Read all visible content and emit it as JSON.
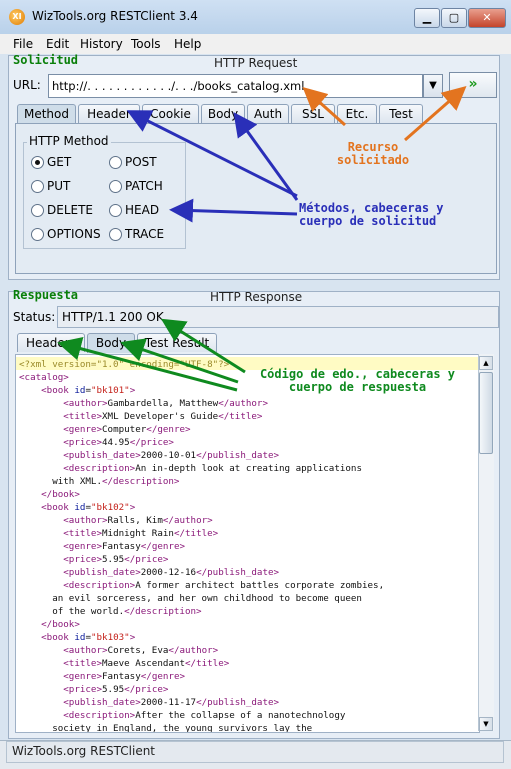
{
  "window": {
    "title": "WizTools.org RESTClient 3.4",
    "icon_text": "XI"
  },
  "window_controls": {
    "minimize": "▁",
    "maximize": "▢",
    "close": "✕"
  },
  "menu": [
    "File",
    "Edit",
    "History",
    "Tools",
    "Help"
  ],
  "request": {
    "section_label": "Solicitud",
    "title": "HTTP Request",
    "url_label": "URL:",
    "url_value": "http://. . . . . . . . . . . ./. . ./books_catalog.xml",
    "dropdown_icon": "▼",
    "go_button": "»",
    "tabs": [
      "Method",
      "Header",
      "Cookie",
      "Body",
      "Auth",
      "SSL",
      "Etc.",
      "Test"
    ],
    "selected_tab": "Method",
    "method_group_title": "HTTP Method",
    "methods": [
      "GET",
      "POST",
      "PUT",
      "PATCH",
      "DELETE",
      "HEAD",
      "OPTIONS",
      "TRACE"
    ],
    "selected_method": "GET"
  },
  "response": {
    "section_label": "Respuesta",
    "title": "HTTP Response",
    "status_label": "Status:",
    "status_value": "HTTP/1.1 200 OK",
    "tabs": [
      "Headers",
      "Body",
      "Test Result"
    ],
    "selected_tab": "Body",
    "body_lines": [
      "<?xml version=\"1.0\" encoding=\"UTF-8\"?>",
      "<catalog>",
      "    <book id=\"bk101\">",
      "        <author>Gambardella, Matthew</author>",
      "        <title>XML Developer's Guide</title>",
      "        <genre>Computer</genre>",
      "        <price>44.95</price>",
      "        <publish_date>2000-10-01</publish_date>",
      "        <description>An in-depth look at creating applications",
      "      with XML.</description>",
      "    </book>",
      "    <book id=\"bk102\">",
      "        <author>Ralls, Kim</author>",
      "        <title>Midnight Rain</title>",
      "        <genre>Fantasy</genre>",
      "        <price>5.95</price>",
      "        <publish_date>2000-12-16</publish_date>",
      "        <description>A former architect battles corporate zombies,",
      "      an evil sorceress, and her own childhood to become queen",
      "      of the world.</description>",
      "    </book>",
      "    <book id=\"bk103\">",
      "        <author>Corets, Eva</author>",
      "        <title>Maeve Ascendant</title>",
      "        <genre>Fantasy</genre>",
      "        <price>5.95</price>",
      "        <publish_date>2000-11-17</publish_date>",
      "        <description>After the collapse of a nanotechnology",
      "      society in England, the young survivors lay the"
    ]
  },
  "status_bar": {
    "text": "WizTools.org RESTClient"
  },
  "annotations": {
    "resource": "Recurso solicitado",
    "methods": "Métodos, cabeceras y cuerpo de solicitud",
    "response": "Código de edo., cabeceras y cuerpo de respuesta"
  },
  "colors": {
    "annotation_orange": "#e3741f",
    "annotation_blue": "#2a2fb8",
    "annotation_green": "#0f8a1f",
    "section_green": "#0a7f0a"
  }
}
